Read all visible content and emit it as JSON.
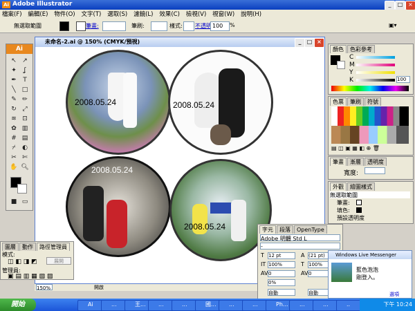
{
  "app": {
    "title": "Adobe Illustrator",
    "logo": "Ai"
  },
  "menu": [
    "檔案(F)",
    "編輯(E)",
    "物件(O)",
    "文字(T)",
    "選取(S)",
    "濾鏡(L)",
    "效果(C)",
    "檢視(V)",
    "視窗(W)",
    "說明(H)"
  ],
  "control": {
    "no_selection": "無選取範圍",
    "stroke_label": "筆畫:",
    "style_label": "樣式:",
    "opacity_label": "不透明度:",
    "opacity_value": "100",
    "percent": "%",
    "brush_label": "筆刷:"
  },
  "document": {
    "title": "未命名-2.ai @ 150% (CMYK/預視)",
    "zoom": "150%",
    "status": "開啟"
  },
  "photos": [
    {
      "date": "2008.05.24"
    },
    {
      "date": "2008.05.24"
    },
    {
      "date": "2008.05.24"
    },
    {
      "date": "2008.05.24"
    }
  ],
  "color_panel": {
    "tabs": [
      "顏色",
      "色彩參考"
    ],
    "channels": [
      {
        "label": "C",
        "value": ""
      },
      {
        "label": "M",
        "value": ""
      },
      {
        "label": "Y",
        "value": ""
      },
      {
        "label": "K",
        "value": "100"
      }
    ]
  },
  "swatch_panel": {
    "tabs": [
      "色票",
      "筆刷",
      "符號"
    ]
  },
  "stroke_panel": {
    "tabs": [
      "筆畫",
      "漸層",
      "透明度"
    ],
    "width_label": "寬度:"
  },
  "appearance_panel": {
    "tabs": [
      "外觀",
      "繪圖樣式"
    ],
    "title": "無選取範圍",
    "rows": [
      "筆畫:",
      "填色:",
      "預設透明度"
    ]
  },
  "char_panel": {
    "tabs": [
      "字元",
      "段落",
      "OpenType"
    ],
    "font": "Adobe 明體 Std L",
    "style": "-",
    "size": "12 pt",
    "leading": "(21 pt)",
    "scale_h": "100%",
    "scale_v": "100%",
    "kerning": "0",
    "tracking": "0",
    "percent": "0%",
    "auto1": "自動",
    "auto2": "自動"
  },
  "path_panel": {
    "tabs": [
      "圖層",
      "動作",
      "路徑管理員"
    ],
    "mode_label": "模式:",
    "expand": "展開",
    "pathfinder_label": "管理員:"
  },
  "messenger": {
    "title": "Windows Live Messenger",
    "line1": "藍色泡泡",
    "line2": "剛登入。",
    "options": "選項"
  },
  "taskbar": {
    "start": "開始",
    "items": [
      "Ai",
      "...",
      "王...",
      "...",
      "...",
      "國...",
      "...",
      "...",
      "Ph...",
      "...",
      "...",
      ".."
    ],
    "time": "下午 10:24"
  },
  "colors": {
    "accent": "#0a3fbf",
    "ai_orange": "#e8881e"
  }
}
